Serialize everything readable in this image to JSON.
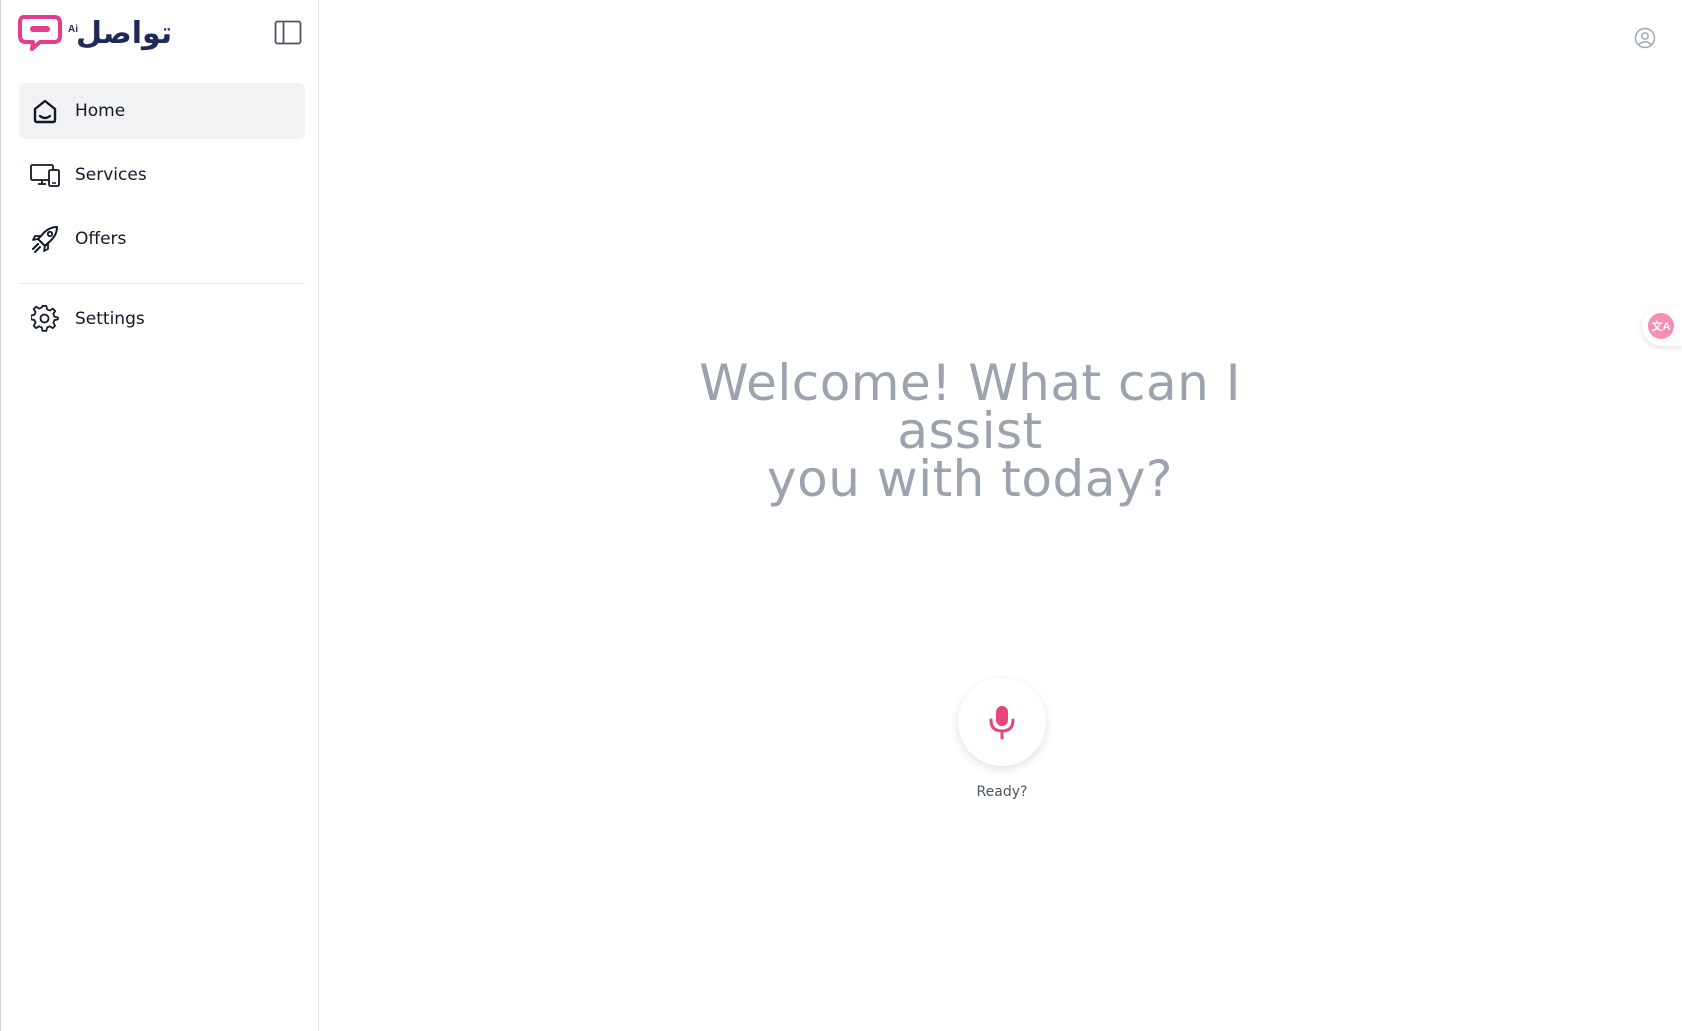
{
  "brand": {
    "logo_text": "تواصل",
    "logo_badge": "Ai",
    "bubble_color": "#e43d8f",
    "text_color": "#1f2a5c"
  },
  "sidebar": {
    "collapse_icon": "sidebar-toggle-icon",
    "items": [
      {
        "label": "Home",
        "icon": "home-icon",
        "active": true
      },
      {
        "label": "Services",
        "icon": "devices-icon",
        "active": false
      },
      {
        "label": "Offers",
        "icon": "rocket-icon",
        "active": false
      }
    ],
    "settings": {
      "label": "Settings",
      "icon": "gear-icon"
    }
  },
  "header": {
    "user_icon": "user-icon"
  },
  "translate": {
    "icon": "translate-icon",
    "glyph": "文A",
    "color": "#f28fb3"
  },
  "main": {
    "welcome_line1": "Welcome! What can I assist",
    "welcome_line2": "you with today?",
    "mic_icon": "microphone-icon",
    "mic_color": "#e8457a",
    "ready_label": "Ready?"
  }
}
